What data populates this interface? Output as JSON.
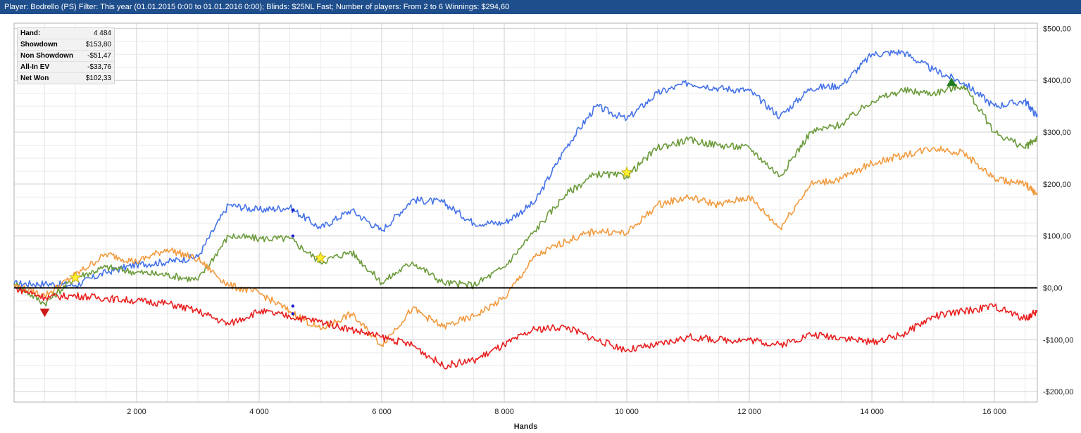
{
  "header": {
    "title": "Player:  Bodrello (PS)  Filter:  This year (01.01.2015 0:00 to 01.01.2016 0:00); Blinds: $25NL Fast; Number of players: From 2 to 6  Winnings:  $294,60"
  },
  "stats": [
    {
      "label": "Hand:",
      "value": "4 484"
    },
    {
      "label": "Showdown",
      "value": "$153,80"
    },
    {
      "label": "Non Showdown",
      "value": "-$51,47"
    },
    {
      "label": "All-In EV",
      "value": "-$33,76"
    },
    {
      "label": "Net Won",
      "value": "$102,33"
    }
  ],
  "chart_data": {
    "type": "line",
    "xlabel": "Hands",
    "ylabel": "",
    "xlim": [
      0,
      16700
    ],
    "ylim": [
      -220,
      510
    ],
    "x_ticks": [
      2000,
      4000,
      6000,
      8000,
      10000,
      12000,
      14000,
      16000
    ],
    "x_tick_labels": [
      "2 000",
      "4 000",
      "6 000",
      "8 000",
      "10 000",
      "12 000",
      "14 000",
      "16 000"
    ],
    "y_ticks": [
      -200,
      -100,
      0,
      100,
      200,
      300,
      400,
      500
    ],
    "y_tick_labels": [
      "-$200,00",
      "-$100,00",
      "$0,00",
      "$100,00",
      "$200,00",
      "$300,00",
      "$400,00",
      "$500,00"
    ],
    "grid": true,
    "zero_line": true,
    "x": [
      0,
      500,
      1000,
      1500,
      2000,
      2500,
      3000,
      3500,
      4000,
      4500,
      5000,
      5500,
      6000,
      6500,
      7000,
      7500,
      8000,
      8500,
      9000,
      9500,
      10000,
      10500,
      11000,
      11500,
      12000,
      12500,
      13000,
      13500,
      14000,
      14500,
      15000,
      15500,
      16000,
      16500,
      16700
    ],
    "series": [
      {
        "color": "#4472e8",
        "values": [
          8,
          8,
          5,
          30,
          45,
          50,
          60,
          160,
          150,
          155,
          115,
          150,
          110,
          170,
          165,
          125,
          125,
          165,
          270,
          350,
          325,
          375,
          395,
          385,
          380,
          330,
          385,
          390,
          450,
          455,
          420,
          395,
          350,
          360,
          330
        ]
      },
      {
        "color": "#6b9a3a",
        "values": [
          8,
          -30,
          20,
          40,
          30,
          25,
          15,
          100,
          95,
          95,
          50,
          70,
          10,
          50,
          10,
          5,
          40,
          110,
          180,
          220,
          215,
          270,
          285,
          275,
          270,
          215,
          300,
          315,
          360,
          380,
          375,
          390,
          300,
          270,
          290
        ]
      },
      {
        "color": "#f29a3e",
        "values": [
          5,
          -15,
          25,
          65,
          50,
          75,
          55,
          5,
          -10,
          -45,
          -80,
          -50,
          -110,
          -40,
          -75,
          -55,
          -20,
          60,
          90,
          110,
          105,
          160,
          175,
          160,
          175,
          115,
          200,
          210,
          240,
          255,
          270,
          260,
          210,
          200,
          180
        ]
      },
      {
        "color": "#e81e1e",
        "values": [
          0,
          -18,
          -15,
          -20,
          -25,
          -30,
          -45,
          -70,
          -45,
          -55,
          -65,
          -80,
          -95,
          -110,
          -150,
          -140,
          -110,
          -80,
          -75,
          -100,
          -120,
          -110,
          -95,
          -100,
          -100,
          -110,
          -90,
          -95,
          -105,
          -90,
          -55,
          -45,
          -35,
          -60,
          -45
        ]
      }
    ],
    "markers": [
      {
        "shape": "triangle-down",
        "color": "#cc1a1a",
        "x": 500,
        "y": -48
      },
      {
        "shape": "triangle-up",
        "color": "#1e7a1e",
        "x": 15300,
        "y": 397
      },
      {
        "shape": "star",
        "color": "#ffee33",
        "x": 1000,
        "y": 20
      },
      {
        "shape": "star",
        "color": "#ffee33",
        "x": 5000,
        "y": 58
      },
      {
        "shape": "star",
        "color": "#ffee33",
        "x": 10000,
        "y": 222
      },
      {
        "shape": "dot",
        "color": "#1c1ccc",
        "x": 4550,
        "y": 150
      },
      {
        "shape": "dot",
        "color": "#1c1ccc",
        "x": 4550,
        "y": 100
      },
      {
        "shape": "dot",
        "color": "#1c1ccc",
        "x": 4550,
        "y": -35
      },
      {
        "shape": "dot",
        "color": "#1c1ccc",
        "x": 4550,
        "y": -50
      }
    ]
  }
}
